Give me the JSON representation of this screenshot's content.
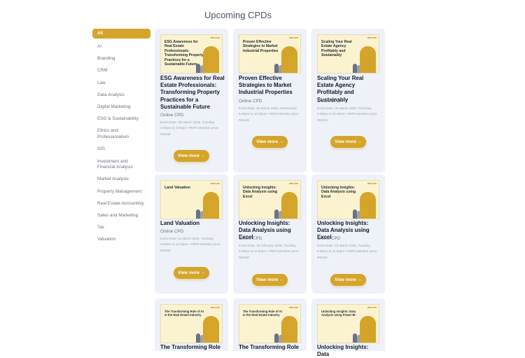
{
  "page": {
    "title": "Upcoming CPDs"
  },
  "sidebar": {
    "items": [
      {
        "label": "All",
        "active": true
      },
      {
        "label": "AI"
      },
      {
        "label": "Branding"
      },
      {
        "label": "CRM"
      },
      {
        "label": "Law"
      },
      {
        "label": "Data Analysis"
      },
      {
        "label": "Digital Marketing"
      },
      {
        "label": "ESG & Sustainability"
      },
      {
        "label": "Ethics and Professionalism"
      },
      {
        "label": "GIS"
      },
      {
        "label": "Investment and Financial Analysis"
      },
      {
        "label": "Market Analysis"
      },
      {
        "label": "Property Management"
      },
      {
        "label": "Real Estate Accounting"
      },
      {
        "label": "Sales and Marketing"
      },
      {
        "label": "Tax"
      },
      {
        "label": "Valuation"
      }
    ]
  },
  "cards": [
    {
      "thumb_text": "ESG Awareness for Real Estate Professionals: Transforming Property Practices for a Sustainable Future",
      "title": "ESG Awareness for Real Estate Professionals: Transforming Property Practices for a Sustainable Future",
      "type": "Online CPD",
      "date": "Event Date: 4th March 2025, Tuesday, 3.00pm to 5.00pm • PEPS Member price: RM150",
      "button": "View more →"
    },
    {
      "thumb_text": "Proven Effective Strategies to Market Industrial Properties",
      "title": "Proven Effective Strategies to Market Industrial Properties",
      "type": "Online CPD",
      "date": "Event Date: 05 March 2025, Wednesday, 8.00pm to 10.00pm • PEPS Member price: RM129",
      "button": "View more →"
    },
    {
      "thumb_text": "Scaling Your Real Estate Agency Profitably and Sustainably",
      "title": "Scaling Your Real Estate Agency Profitably and Sustainably",
      "type": "Online CPD",
      "date": "Event Date: 06 March 2025, Thursday, 8.00pm to 10.00pm • PEPS Member price: RM129",
      "button": "View more →"
    },
    {
      "thumb_text": "Land Valuation",
      "title": "Land Valuation",
      "type": "Online CPD",
      "date": "Event Date: 11 March 2025, Tuesday, 9.00am to 12.00pm • PEPS Member price: RM150",
      "button": "View more →"
    },
    {
      "thumb_text": "Unlocking Insights: Data Analysis using Excel",
      "title": "Unlocking Insights: Data Analysis using Excel",
      "type": "Online CPD",
      "date": "Event Date: 18 February 2025, Tuesday, 9.00am to 11.00pm • PEPS Member price: RM150",
      "button": "View more →"
    },
    {
      "thumb_text": "Unlocking Insights: Data Analysis using Excel",
      "title": "Unlocking Insights: Data Analysis using Excel",
      "type": "Online CPD",
      "date": "Event Date: 18 March 2025, Tuesday, 9.00am to 11.00pm • PEPS Member price: RM150",
      "button": "View more →"
    },
    {
      "thumb_text": "The Transforming Role of AI in the Real Estate Industry",
      "title": "The Transforming Role",
      "type": "",
      "date": "",
      "button": ""
    },
    {
      "thumb_text": "The Transforming Role of AI in the Real Estate Industry",
      "title": "The Transforming Role",
      "type": "",
      "date": "",
      "button": ""
    },
    {
      "thumb_text": "Unlocking Insights: Data Analysis using Power BI",
      "title": "Unlocking Insights: Data",
      "type": "",
      "date": "",
      "button": ""
    }
  ],
  "brand": {
    "logo_text": "PEPS CPD",
    "accent": "#d4a52a",
    "card_bg": "#eef1f8",
    "thumb_bg": "#fbf2cf"
  }
}
